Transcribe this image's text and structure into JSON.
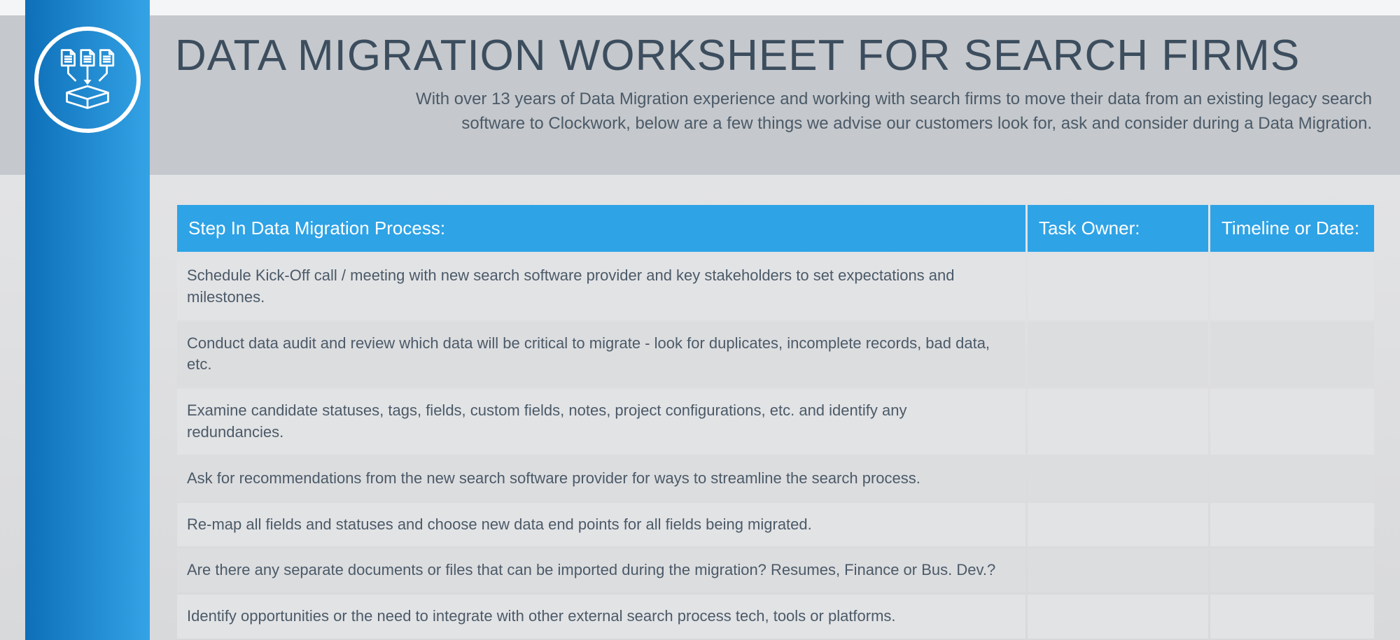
{
  "header": {
    "title": "DATA MIGRATION WORKSHEET FOR SEARCH FIRMS",
    "subtitle": "With over 13 years of Data Migration experience and working with search firms to move their data from an existing legacy search software to Clockwork, below are a few things we advise our customers look for, ask and consider during a Data Migration."
  },
  "table": {
    "headers": {
      "step": "Step In Data Migration Process:",
      "owner": "Task Owner:",
      "date": "Timeline or Date:"
    },
    "rows": [
      {
        "step": "Schedule Kick-Off call / meeting with new search software provider and key stakeholders to set expectations and milestones.",
        "owner": "",
        "date": ""
      },
      {
        "step": "Conduct data audit and review which data will be critical to migrate - look for duplicates, incomplete records, bad data, etc.",
        "owner": "",
        "date": ""
      },
      {
        "step": "Examine candidate statuses, tags, fields, custom fields, notes, project configurations, etc. and identify any redundancies.",
        "owner": "",
        "date": ""
      },
      {
        "step": "Ask for recommendations from the new search software provider for ways to streamline the search process.",
        "owner": "",
        "date": ""
      },
      {
        "step": "Re-map all fields and statuses and choose new data end points for all fields being migrated.",
        "owner": "",
        "date": ""
      },
      {
        "step": "Are there any separate documents or files that can be imported during the migration? Resumes, Finance or Bus. Dev.?",
        "owner": "",
        "date": ""
      },
      {
        "step": "Identify opportunities or the need to integrate with other external search process tech, tools or platforms.",
        "owner": "",
        "date": ""
      }
    ]
  }
}
